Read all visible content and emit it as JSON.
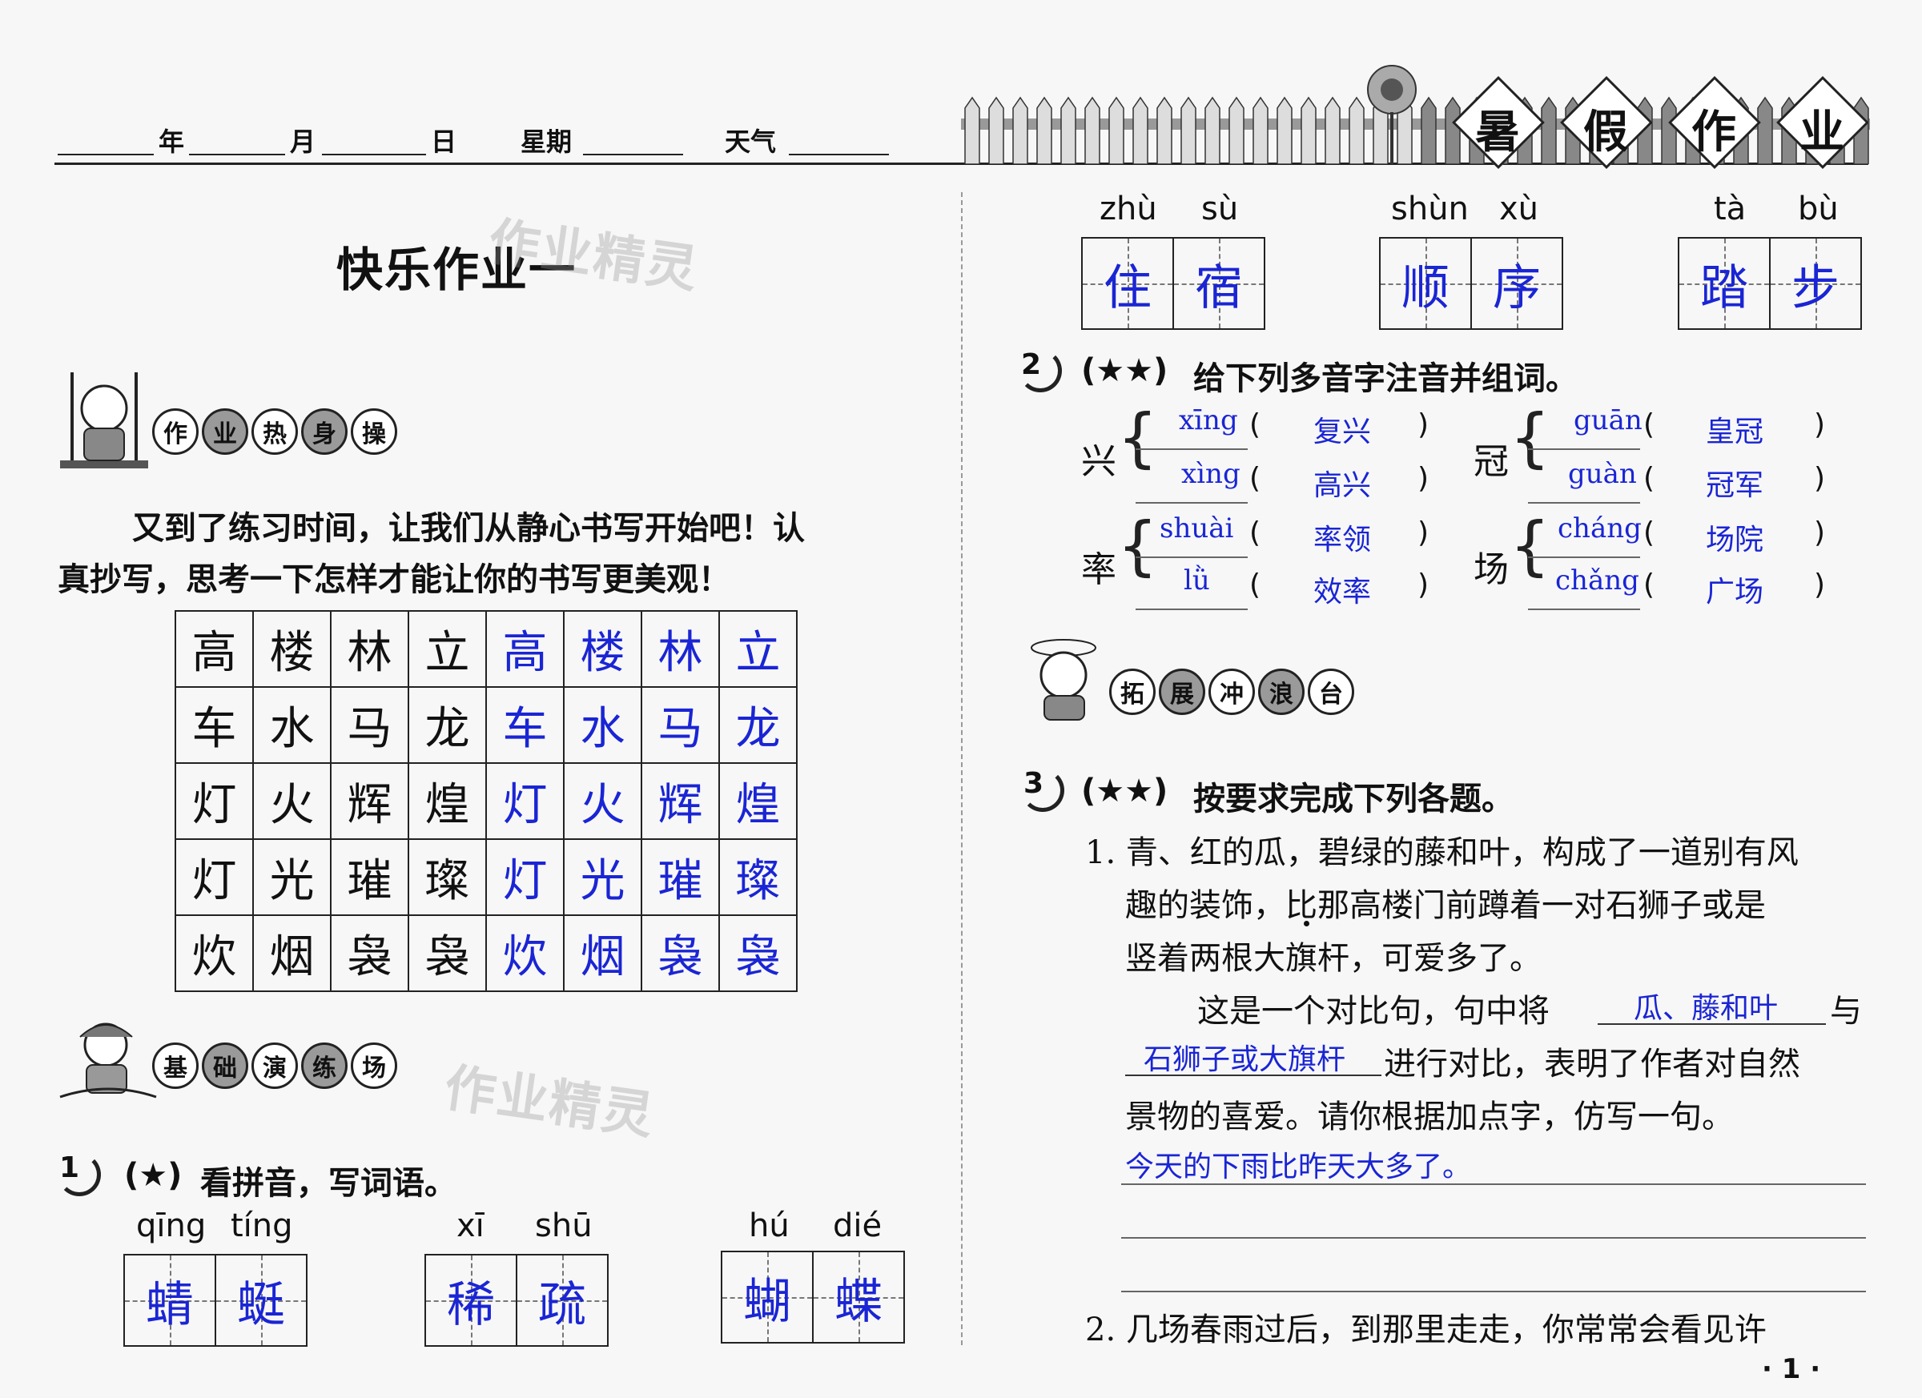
{
  "header": {
    "year_label": "年",
    "month_label": "月",
    "day_label": "日",
    "weekday_label": "星期",
    "weather_label": "天气",
    "banner": [
      "暑",
      "假",
      "作",
      "业"
    ]
  },
  "title": "快乐作业一",
  "watermark": "作业精灵",
  "sections": {
    "warmup": [
      "作",
      "业",
      "热",
      "身",
      "操"
    ],
    "basic": [
      "基",
      "础",
      "演",
      "练",
      "场"
    ],
    "extend": [
      "拓",
      "展",
      "冲",
      "浪",
      "台"
    ]
  },
  "warmup_text": [
    "又到了练习时间，让我们从静心书写开始吧！认",
    "真抄写，思考一下怎样才能让你的书写更美观！"
  ],
  "copy_grid": [
    {
      "printed": [
        "高",
        "楼",
        "林",
        "立"
      ],
      "written": [
        "高",
        "楼",
        "林",
        "立"
      ]
    },
    {
      "printed": [
        "车",
        "水",
        "马",
        "龙"
      ],
      "written": [
        "车",
        "水",
        "马",
        "龙"
      ]
    },
    {
      "printed": [
        "灯",
        "火",
        "辉",
        "煌"
      ],
      "written": [
        "灯",
        "火",
        "辉",
        "煌"
      ]
    },
    {
      "printed": [
        "灯",
        "光",
        "璀",
        "璨"
      ],
      "written": [
        "灯",
        "光",
        "璀",
        "璨"
      ]
    },
    {
      "printed": [
        "炊",
        "烟",
        "袅",
        "袅"
      ],
      "written": [
        "炊",
        "烟",
        "袅",
        "袅"
      ]
    }
  ],
  "q1": {
    "num": "1",
    "stars": "(★)",
    "text": "看拼音，写词语。",
    "words": [
      {
        "pinyin": [
          "qīng",
          "tíng"
        ],
        "chars": [
          "蜻",
          "蜓"
        ]
      },
      {
        "pinyin": [
          "xī",
          "shū"
        ],
        "chars": [
          "稀",
          "疏"
        ]
      },
      {
        "pinyin": [
          "hú",
          "dié"
        ],
        "chars": [
          "蝴",
          "蝶"
        ]
      },
      {
        "pinyin": [
          "zhù",
          "sù"
        ],
        "chars": [
          "住",
          "宿"
        ]
      },
      {
        "pinyin": [
          "shùn",
          "xù"
        ],
        "chars": [
          "顺",
          "序"
        ]
      },
      {
        "pinyin": [
          "tà",
          "bù"
        ],
        "chars": [
          "踏",
          "步"
        ]
      }
    ]
  },
  "q2": {
    "num": "2",
    "stars": "(★★)",
    "text": "给下列多音字注音并组词。",
    "groups": [
      {
        "char": "兴",
        "items": [
          {
            "pinyin": "xīng",
            "word": "复兴"
          },
          {
            "pinyin": "xìng",
            "word": "高兴"
          }
        ]
      },
      {
        "char": "冠",
        "items": [
          {
            "pinyin": "guān",
            "word": "皇冠"
          },
          {
            "pinyin": "guàn",
            "word": "冠军"
          }
        ]
      },
      {
        "char": "率",
        "items": [
          {
            "pinyin": "shuài",
            "word": "率领"
          },
          {
            "pinyin": "lǜ",
            "word": "效率"
          }
        ]
      },
      {
        "char": "场",
        "items": [
          {
            "pinyin": "cháng",
            "word": "场院"
          },
          {
            "pinyin": "chǎng",
            "word": "广场"
          }
        ]
      }
    ]
  },
  "q3": {
    "num": "3",
    "stars": "(★★)",
    "text": "按要求完成下列各题。",
    "item1_lines": [
      "1. 青、红的瓜，碧绿的藤和叶，构成了一道别有风",
      "趣的装饰，比那高楼门前蹲着一对石狮子或是",
      "竖着两根大旗杆，可爱多了。"
    ],
    "item1_p2_a": "这是一个对比句，句中将",
    "answer_a": "瓜、藤和叶",
    "item1_p2_b": "与",
    "answer_b": "石狮子或大旗杆",
    "item1_p2_c": "进行对比，表明了作者对自然",
    "item1_p2_d": "景物的喜爱。请你根据加点字，仿写一句。",
    "answer_c": "今天的下雨比昨天大多了。",
    "item2": "2. 几场春雨过后，到那里走走，你常常会看见许"
  },
  "page_number": "· 1 ·"
}
